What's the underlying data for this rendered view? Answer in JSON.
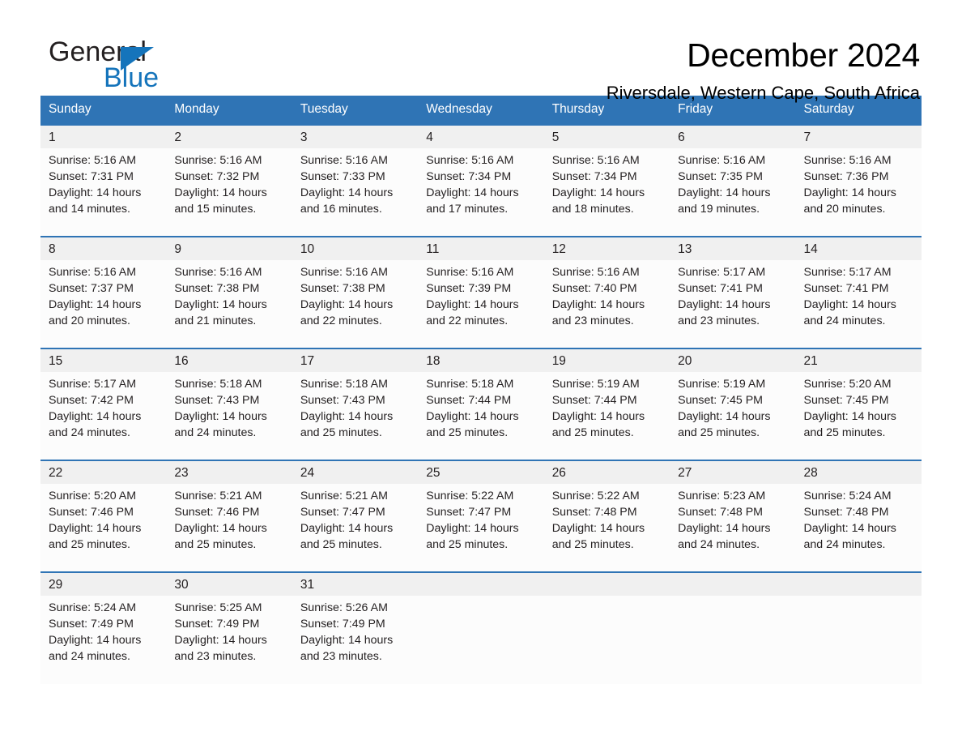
{
  "brand": {
    "name_part1": "General",
    "name_part2": "Blue",
    "triangle_color": "#1574bb"
  },
  "header": {
    "month_title": "December 2024",
    "location": "Riversdale, Western Cape, South Africa"
  },
  "theme": {
    "header_blue": "#2f74b5",
    "row_divider_blue": "#2f74b5",
    "date_band_gray": "#f0f0f0",
    "cell_background": "#fcfcfc",
    "text_color": "#231f20"
  },
  "weekday_headers": [
    "Sunday",
    "Monday",
    "Tuesday",
    "Wednesday",
    "Thursday",
    "Friday",
    "Saturday"
  ],
  "weeks": [
    {
      "days": [
        {
          "date": "1",
          "sunrise": "Sunrise: 5:16 AM",
          "sunset": "Sunset: 7:31 PM",
          "daylight_line1": "Daylight: 14 hours",
          "daylight_line2": "and 14 minutes."
        },
        {
          "date": "2",
          "sunrise": "Sunrise: 5:16 AM",
          "sunset": "Sunset: 7:32 PM",
          "daylight_line1": "Daylight: 14 hours",
          "daylight_line2": "and 15 minutes."
        },
        {
          "date": "3",
          "sunrise": "Sunrise: 5:16 AM",
          "sunset": "Sunset: 7:33 PM",
          "daylight_line1": "Daylight: 14 hours",
          "daylight_line2": "and 16 minutes."
        },
        {
          "date": "4",
          "sunrise": "Sunrise: 5:16 AM",
          "sunset": "Sunset: 7:34 PM",
          "daylight_line1": "Daylight: 14 hours",
          "daylight_line2": "and 17 minutes."
        },
        {
          "date": "5",
          "sunrise": "Sunrise: 5:16 AM",
          "sunset": "Sunset: 7:34 PM",
          "daylight_line1": "Daylight: 14 hours",
          "daylight_line2": "and 18 minutes."
        },
        {
          "date": "6",
          "sunrise": "Sunrise: 5:16 AM",
          "sunset": "Sunset: 7:35 PM",
          "daylight_line1": "Daylight: 14 hours",
          "daylight_line2": "and 19 minutes."
        },
        {
          "date": "7",
          "sunrise": "Sunrise: 5:16 AM",
          "sunset": "Sunset: 7:36 PM",
          "daylight_line1": "Daylight: 14 hours",
          "daylight_line2": "and 20 minutes."
        }
      ]
    },
    {
      "days": [
        {
          "date": "8",
          "sunrise": "Sunrise: 5:16 AM",
          "sunset": "Sunset: 7:37 PM",
          "daylight_line1": "Daylight: 14 hours",
          "daylight_line2": "and 20 minutes."
        },
        {
          "date": "9",
          "sunrise": "Sunrise: 5:16 AM",
          "sunset": "Sunset: 7:38 PM",
          "daylight_line1": "Daylight: 14 hours",
          "daylight_line2": "and 21 minutes."
        },
        {
          "date": "10",
          "sunrise": "Sunrise: 5:16 AM",
          "sunset": "Sunset: 7:38 PM",
          "daylight_line1": "Daylight: 14 hours",
          "daylight_line2": "and 22 minutes."
        },
        {
          "date": "11",
          "sunrise": "Sunrise: 5:16 AM",
          "sunset": "Sunset: 7:39 PM",
          "daylight_line1": "Daylight: 14 hours",
          "daylight_line2": "and 22 minutes."
        },
        {
          "date": "12",
          "sunrise": "Sunrise: 5:16 AM",
          "sunset": "Sunset: 7:40 PM",
          "daylight_line1": "Daylight: 14 hours",
          "daylight_line2": "and 23 minutes."
        },
        {
          "date": "13",
          "sunrise": "Sunrise: 5:17 AM",
          "sunset": "Sunset: 7:41 PM",
          "daylight_line1": "Daylight: 14 hours",
          "daylight_line2": "and 23 minutes."
        },
        {
          "date": "14",
          "sunrise": "Sunrise: 5:17 AM",
          "sunset": "Sunset: 7:41 PM",
          "daylight_line1": "Daylight: 14 hours",
          "daylight_line2": "and 24 minutes."
        }
      ]
    },
    {
      "days": [
        {
          "date": "15",
          "sunrise": "Sunrise: 5:17 AM",
          "sunset": "Sunset: 7:42 PM",
          "daylight_line1": "Daylight: 14 hours",
          "daylight_line2": "and 24 minutes."
        },
        {
          "date": "16",
          "sunrise": "Sunrise: 5:18 AM",
          "sunset": "Sunset: 7:43 PM",
          "daylight_line1": "Daylight: 14 hours",
          "daylight_line2": "and 24 minutes."
        },
        {
          "date": "17",
          "sunrise": "Sunrise: 5:18 AM",
          "sunset": "Sunset: 7:43 PM",
          "daylight_line1": "Daylight: 14 hours",
          "daylight_line2": "and 25 minutes."
        },
        {
          "date": "18",
          "sunrise": "Sunrise: 5:18 AM",
          "sunset": "Sunset: 7:44 PM",
          "daylight_line1": "Daylight: 14 hours",
          "daylight_line2": "and 25 minutes."
        },
        {
          "date": "19",
          "sunrise": "Sunrise: 5:19 AM",
          "sunset": "Sunset: 7:44 PM",
          "daylight_line1": "Daylight: 14 hours",
          "daylight_line2": "and 25 minutes."
        },
        {
          "date": "20",
          "sunrise": "Sunrise: 5:19 AM",
          "sunset": "Sunset: 7:45 PM",
          "daylight_line1": "Daylight: 14 hours",
          "daylight_line2": "and 25 minutes."
        },
        {
          "date": "21",
          "sunrise": "Sunrise: 5:20 AM",
          "sunset": "Sunset: 7:45 PM",
          "daylight_line1": "Daylight: 14 hours",
          "daylight_line2": "and 25 minutes."
        }
      ]
    },
    {
      "days": [
        {
          "date": "22",
          "sunrise": "Sunrise: 5:20 AM",
          "sunset": "Sunset: 7:46 PM",
          "daylight_line1": "Daylight: 14 hours",
          "daylight_line2": "and 25 minutes."
        },
        {
          "date": "23",
          "sunrise": "Sunrise: 5:21 AM",
          "sunset": "Sunset: 7:46 PM",
          "daylight_line1": "Daylight: 14 hours",
          "daylight_line2": "and 25 minutes."
        },
        {
          "date": "24",
          "sunrise": "Sunrise: 5:21 AM",
          "sunset": "Sunset: 7:47 PM",
          "daylight_line1": "Daylight: 14 hours",
          "daylight_line2": "and 25 minutes."
        },
        {
          "date": "25",
          "sunrise": "Sunrise: 5:22 AM",
          "sunset": "Sunset: 7:47 PM",
          "daylight_line1": "Daylight: 14 hours",
          "daylight_line2": "and 25 minutes."
        },
        {
          "date": "26",
          "sunrise": "Sunrise: 5:22 AM",
          "sunset": "Sunset: 7:48 PM",
          "daylight_line1": "Daylight: 14 hours",
          "daylight_line2": "and 25 minutes."
        },
        {
          "date": "27",
          "sunrise": "Sunrise: 5:23 AM",
          "sunset": "Sunset: 7:48 PM",
          "daylight_line1": "Daylight: 14 hours",
          "daylight_line2": "and 24 minutes."
        },
        {
          "date": "28",
          "sunrise": "Sunrise: 5:24 AM",
          "sunset": "Sunset: 7:48 PM",
          "daylight_line1": "Daylight: 14 hours",
          "daylight_line2": "and 24 minutes."
        }
      ]
    },
    {
      "days": [
        {
          "date": "29",
          "sunrise": "Sunrise: 5:24 AM",
          "sunset": "Sunset: 7:49 PM",
          "daylight_line1": "Daylight: 14 hours",
          "daylight_line2": "and 24 minutes."
        },
        {
          "date": "30",
          "sunrise": "Sunrise: 5:25 AM",
          "sunset": "Sunset: 7:49 PM",
          "daylight_line1": "Daylight: 14 hours",
          "daylight_line2": "and 23 minutes."
        },
        {
          "date": "31",
          "sunrise": "Sunrise: 5:26 AM",
          "sunset": "Sunset: 7:49 PM",
          "daylight_line1": "Daylight: 14 hours",
          "daylight_line2": "and 23 minutes."
        },
        {
          "date": "",
          "sunrise": "",
          "sunset": "",
          "daylight_line1": "",
          "daylight_line2": ""
        },
        {
          "date": "",
          "sunrise": "",
          "sunset": "",
          "daylight_line1": "",
          "daylight_line2": ""
        },
        {
          "date": "",
          "sunrise": "",
          "sunset": "",
          "daylight_line1": "",
          "daylight_line2": ""
        },
        {
          "date": "",
          "sunrise": "",
          "sunset": "",
          "daylight_line1": "",
          "daylight_line2": ""
        }
      ]
    }
  ]
}
